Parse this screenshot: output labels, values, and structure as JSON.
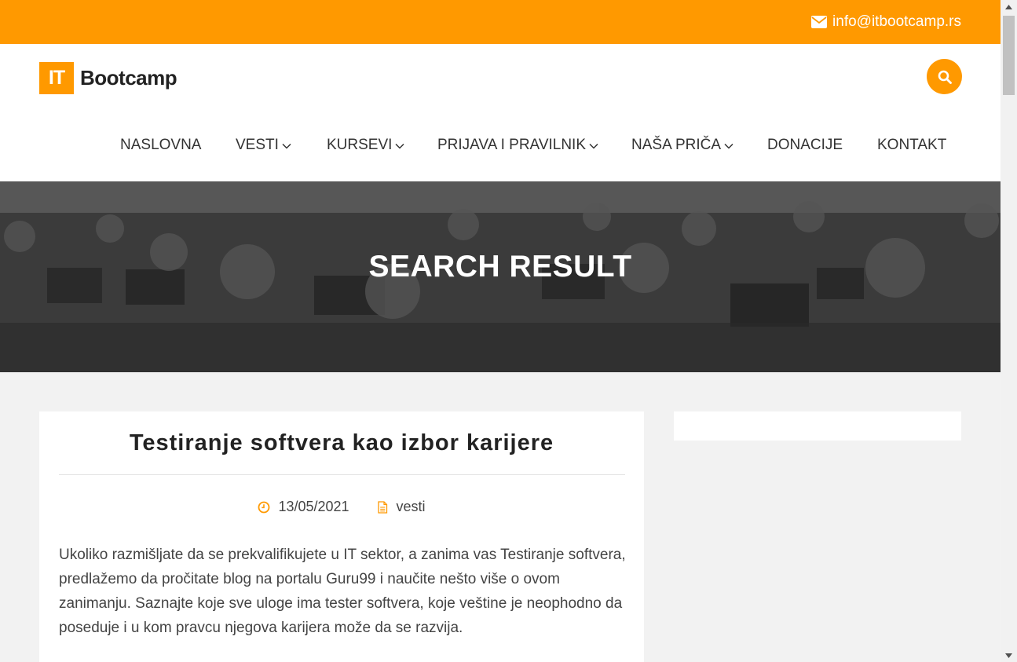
{
  "topbar": {
    "email": "info@itbootcamp.rs",
    "email_icon": "envelope-icon"
  },
  "logo": {
    "mark": "IT",
    "text": "Bootcamp"
  },
  "search": {
    "icon": "search-icon"
  },
  "nav": {
    "items": [
      {
        "label": "NASLOVNA"
      },
      {
        "label": "VESTI"
      },
      {
        "label": "KURSEVI"
      },
      {
        "label": "PRIJAVA I PRAVILNIK"
      },
      {
        "label": "NAŠA PRIČA"
      },
      {
        "label": "DONACIJE"
      },
      {
        "label": "KONTAKT"
      }
    ]
  },
  "hero": {
    "title": "SEARCH RESULT"
  },
  "post": {
    "title": "Testiranje softvera kao izbor karijere",
    "date": "13/05/2021",
    "category": "vesti",
    "excerpt": "Ukoliko razmišljate da se prekvalifikujete u IT sektor, a zanima vas Testiranje softvera, predlažemo da pročitate blog na portalu Guru99 i naučite nešto više o ovom zanimanju. Saznajte koje sve uloge ima tester softvera, koje veštine je neophodno da poseduje i u kom pravcu njegova karijera može da se razvija."
  },
  "colors": {
    "accent": "#ff9900",
    "text": "#333333",
    "background": "#f2f2f2"
  }
}
